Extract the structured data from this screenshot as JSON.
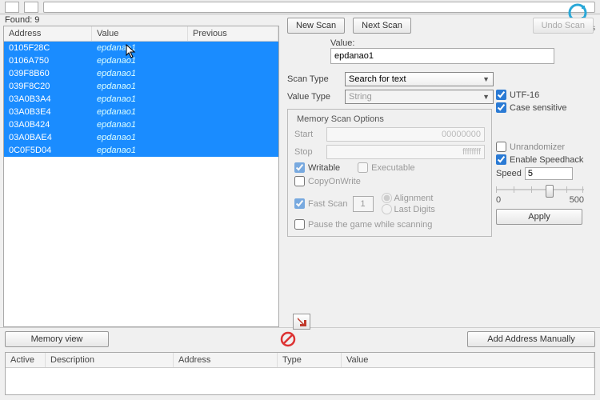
{
  "found_label": "Found: 9",
  "settings_label": "Settings",
  "columns": {
    "address": "Address",
    "value": "Value",
    "previous": "Previous"
  },
  "results": [
    {
      "addr": "0105F28C",
      "val": "epdanao1"
    },
    {
      "addr": "0106A750",
      "val": "epdanao1"
    },
    {
      "addr": "039F8B60",
      "val": "epdanao1"
    },
    {
      "addr": "039F8C20",
      "val": "epdanao1"
    },
    {
      "addr": "03A0B3A4",
      "val": "epdanao1"
    },
    {
      "addr": "03A0B3E4",
      "val": "epdanao1"
    },
    {
      "addr": "03A0B424",
      "val": "epdanao1"
    },
    {
      "addr": "03A0BAE4",
      "val": "epdanao1"
    },
    {
      "addr": "0C0F5D04",
      "val": "epdanao1"
    }
  ],
  "buttons": {
    "new_scan": "New Scan",
    "next_scan": "Next Scan",
    "undo_scan": "Undo Scan",
    "memory_view": "Memory view",
    "add_manual": "Add Address Manually",
    "apply": "Apply"
  },
  "labels": {
    "value": "Value:",
    "scan_type": "Scan Type",
    "value_type": "Value Type",
    "mem_opts": "Memory Scan Options",
    "start": "Start",
    "stop": "Stop",
    "writable": "Writable",
    "executable": "Executable",
    "copyonwrite": "CopyOnWrite",
    "fast_scan": "Fast Scan",
    "alignment": "Alignment",
    "last_digits": "Last Digits",
    "pause": "Pause the game while scanning",
    "utf16": "UTF-16",
    "case": "Case sensitive",
    "unrandom": "Unrandomizer",
    "speedhack": "Enable Speedhack",
    "speed": "Speed"
  },
  "values": {
    "search": "epdanao1",
    "scan_type": "Search for text",
    "value_type": "String",
    "start": "00000000",
    "stop": "ffffffff",
    "fast": "1",
    "speed": "5",
    "slider_min": "0",
    "slider_max": "500"
  },
  "addr_columns": {
    "active": "Active",
    "desc": "Description",
    "addr": "Address",
    "type": "Type",
    "value": "Value"
  }
}
